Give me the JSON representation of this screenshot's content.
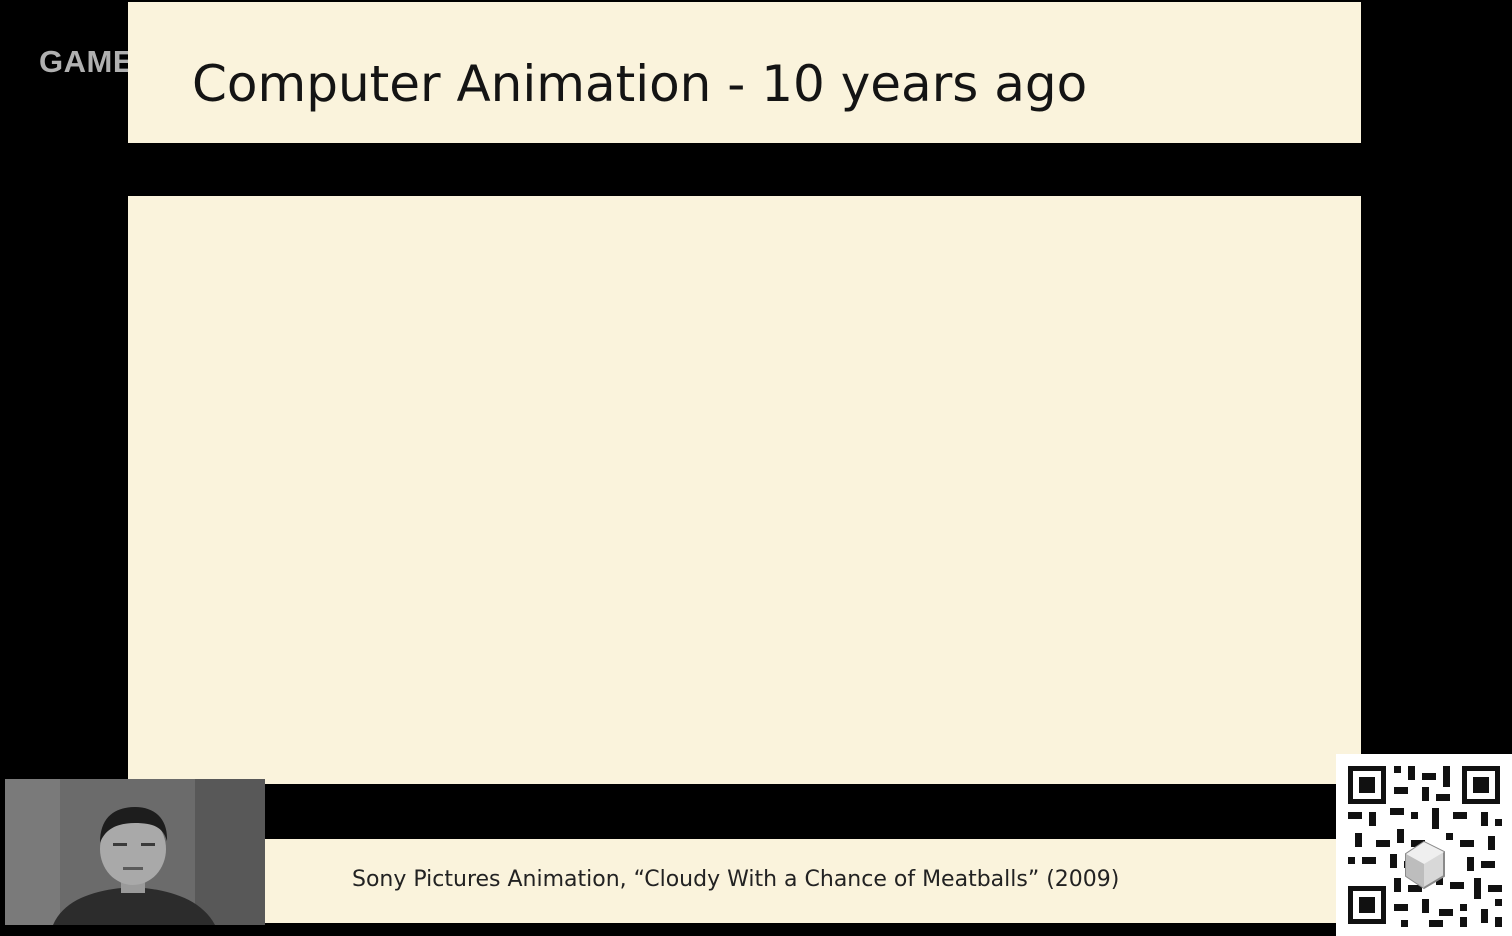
{
  "watermark": {
    "text": "GAME"
  },
  "slide": {
    "title": "Computer Animation - 10 years ago",
    "caption": "Sony Pictures Animation, “Cloudy With a Chance of Meatballs” (2009)"
  },
  "icons": {
    "qr": "qr-code-icon",
    "webcam": "webcam-feed"
  },
  "colors": {
    "slide_background": "#faf3dc",
    "page_background": "#000000",
    "title_text": "#141414"
  }
}
